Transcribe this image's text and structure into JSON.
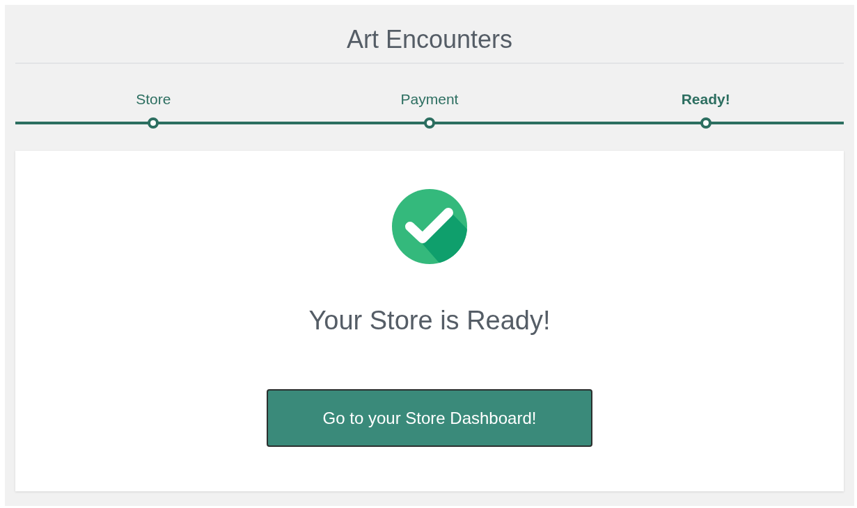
{
  "title": "Art Encounters",
  "steps": [
    {
      "label": "Store",
      "selected": false
    },
    {
      "label": "Payment",
      "selected": false
    },
    {
      "label": "Ready!",
      "selected": true
    }
  ],
  "message": "Your Store is Ready!",
  "button": "Go to your Store Dashboard!"
}
